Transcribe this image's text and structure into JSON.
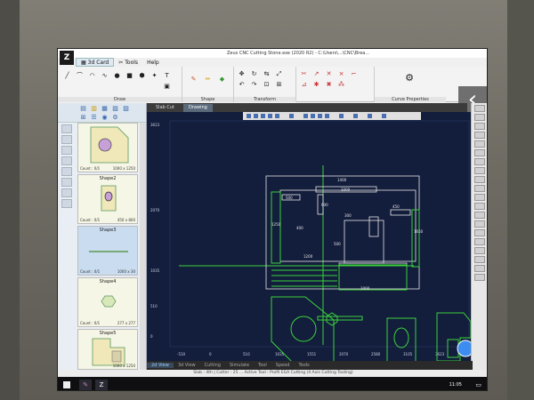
{
  "app": {
    "logo": "Z",
    "title": "Zeus CNC Cutting Stone.exe (2020 R2) - C:\\Users\\...\\CNC\\Brea..."
  },
  "menu": {
    "items": [
      "3d Card",
      "Tools",
      "Help"
    ]
  },
  "ribbon": {
    "groups": [
      "Draw",
      "Shape",
      "Transform",
      "Curve Properties"
    ]
  },
  "shapes": {
    "items": [
      {
        "name": "",
        "count": "Count : 0/1",
        "dims": "1000 x 1250"
      },
      {
        "name": "Shape2",
        "count": "Count : 0/1",
        "dims": "450 x 800"
      },
      {
        "name": "Shape3",
        "count": "Count : 0/1",
        "dims": "1000 x 30"
      },
      {
        "name": "Shape4",
        "count": "Count : 0/1",
        "dims": "277 x 277"
      },
      {
        "name": "Shape5",
        "count": "Count : 0/1",
        "dims": "1000 x 1250"
      }
    ]
  },
  "doc_tabs": [
    "Slab Cut",
    "Drawing"
  ],
  "bottom_tabs": [
    "2d View",
    "3d View",
    "Cutting",
    "Simulate",
    "Tool",
    "Speed",
    "Tools"
  ],
  "status": "Slab : 4th | Cutter : 25 ... Active Tool : Profil EGA Cutting (4 Axis Cutting Tooling)",
  "canvas": {
    "y_ticks": [
      "3623",
      "2070",
      "1035",
      "510",
      "0"
    ],
    "x_ticks": [
      "-510",
      "0",
      "510",
      "1035",
      "1551",
      "2070",
      "2580",
      "3105",
      "3623"
    ],
    "dims": {
      "top": "1400",
      "d1000": "1000",
      "d500": "500",
      "d300": "300",
      "d450": "450",
      "d400": "400",
      "d1200": "1200",
      "d1250": "1250",
      "d1650": "1650",
      "d600": "600",
      "d500b": "500",
      "d1000b": "1000"
    }
  },
  "taskbar": {
    "time": "11:05",
    "date": ""
  }
}
